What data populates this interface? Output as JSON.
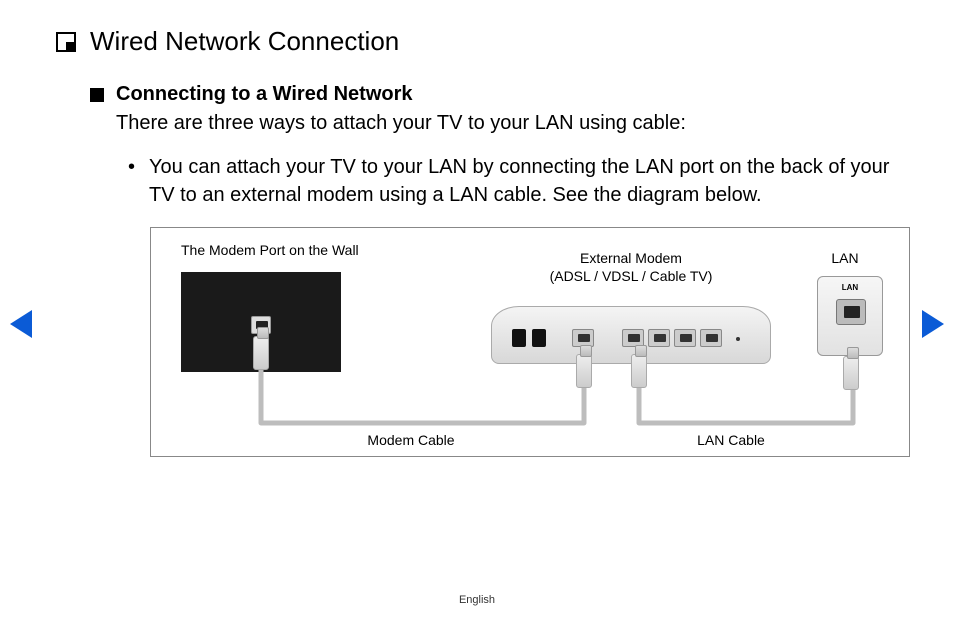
{
  "title": "Wired Network Connection",
  "section": {
    "heading": "Connecting to a Wired Network",
    "intro": "There are three ways to attach your TV to your LAN using cable:",
    "bullet1": "You can attach your TV to your LAN by connecting the LAN port on the back of your TV to an external modem using a LAN cable. See the diagram below."
  },
  "diagram": {
    "wall_label": "The Modem Port on the Wall",
    "external_modem_line1": "External Modem",
    "external_modem_line2": "(ADSL / VDSL / Cable TV)",
    "lan_label": "LAN",
    "lan_port_tag": "LAN",
    "modem_cable": "Modem Cable",
    "lan_cable": "LAN Cable"
  },
  "footer": {
    "language": "English"
  },
  "nav": {
    "prev": "Previous page",
    "next": "Next page"
  }
}
